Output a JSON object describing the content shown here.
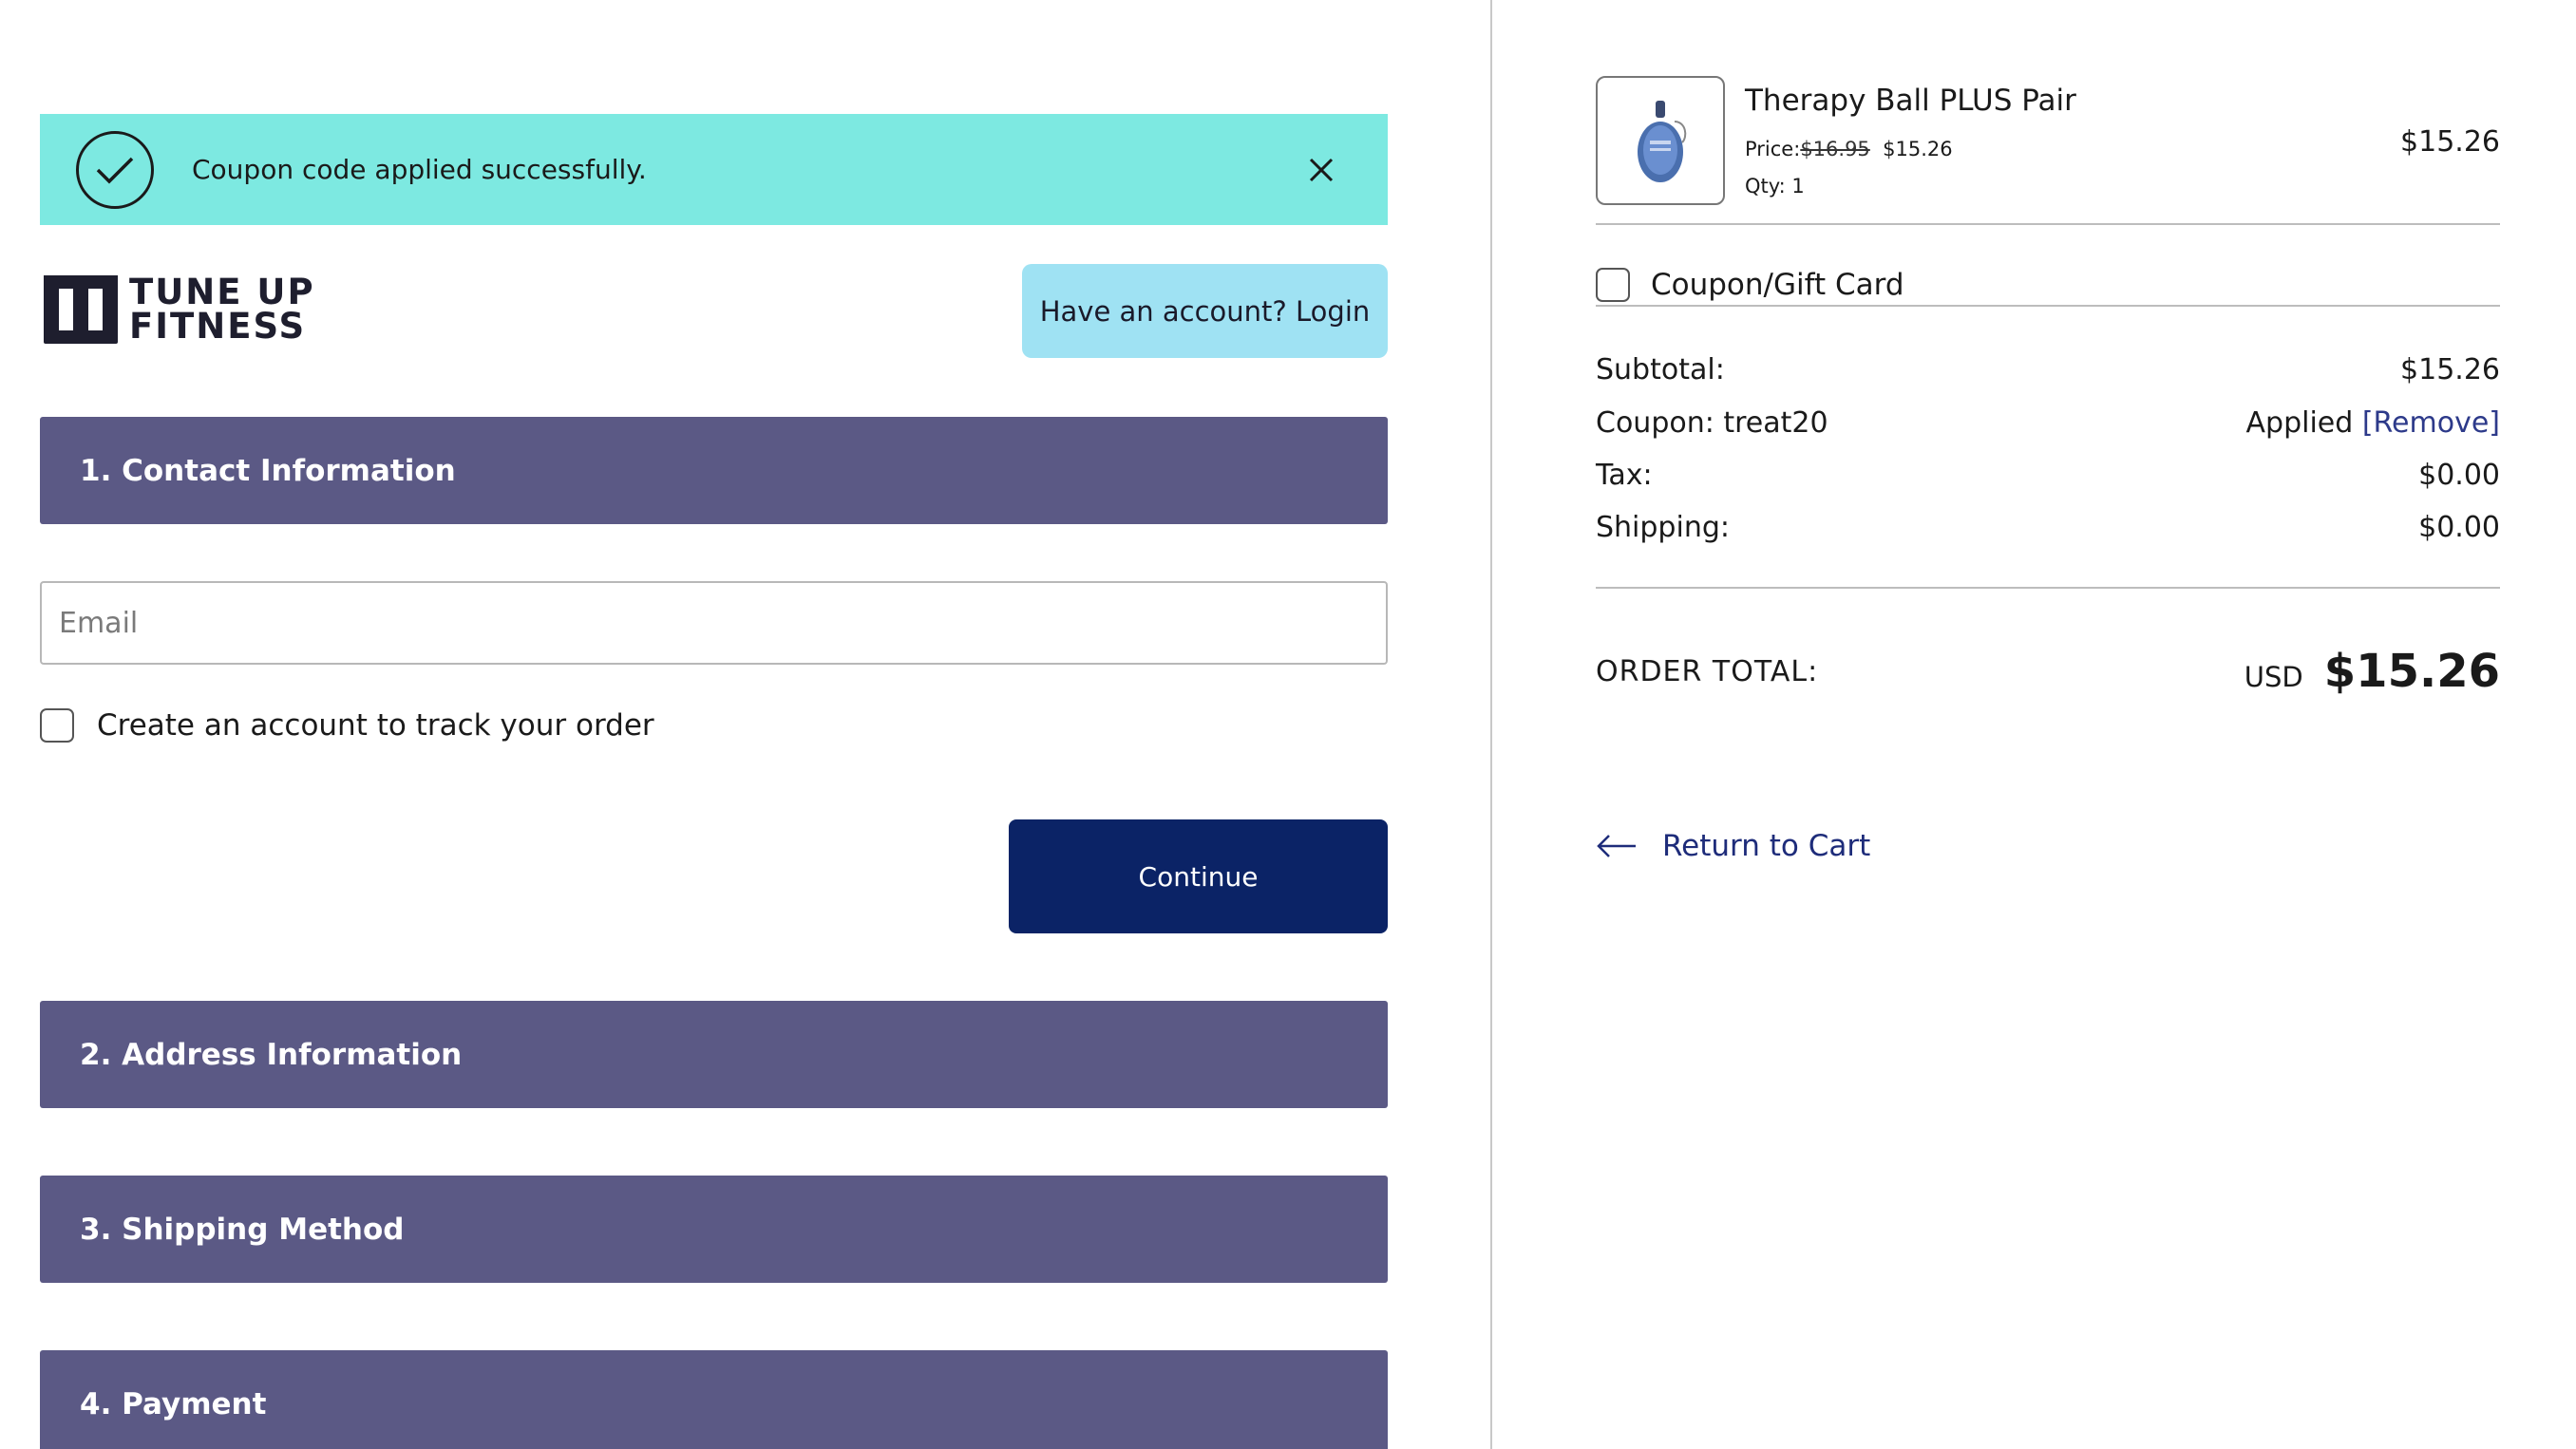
{
  "banner": {
    "message": "Coupon code applied successfully.",
    "color": "#7de9e1"
  },
  "brand": {
    "line1": "TUNE UP",
    "line2": "FITNESS"
  },
  "header": {
    "login_label": "Have an account? Login"
  },
  "sections": [
    {
      "label": "1. Contact Information"
    },
    {
      "label": "2. Address Information"
    },
    {
      "label": "3. Shipping Method"
    },
    {
      "label": "4. Payment"
    }
  ],
  "contact": {
    "email_placeholder": "Email",
    "email_value": "",
    "create_account_label": "Create an account to track your order",
    "create_account_checked": false,
    "continue_label": "Continue"
  },
  "cart": {
    "item": {
      "name": "Therapy Ball PLUS Pair",
      "price_label": "Price:",
      "original_price": "$16.95",
      "sale_price": "$15.26",
      "qty_label": "Qty: 1",
      "line_total": "$15.26"
    },
    "coupon_gift_label": "Coupon/Gift Card",
    "subtotal_label": "Subtotal:",
    "subtotal_value": "$15.26",
    "coupon_label": "Coupon: treat20",
    "coupon_status": "Applied",
    "coupon_remove": "[Remove]",
    "tax_label": "Tax:",
    "tax_value": "$0.00",
    "shipping_label": "Shipping:",
    "shipping_value": "$0.00",
    "order_total_label": "ORDER TOTAL:",
    "order_total_currency": "USD",
    "order_total_value": "$15.26",
    "return_label": "Return to Cart"
  },
  "colors": {
    "section_bar": "#5b5985",
    "continue_button": "#0b2366",
    "login_button": "#9fe2f3",
    "link": "#2d3a8a"
  },
  "icons": [
    "check-circle-icon",
    "close-icon",
    "brand-logo-icon",
    "therapy-ball-image",
    "arrow-left-icon"
  ]
}
